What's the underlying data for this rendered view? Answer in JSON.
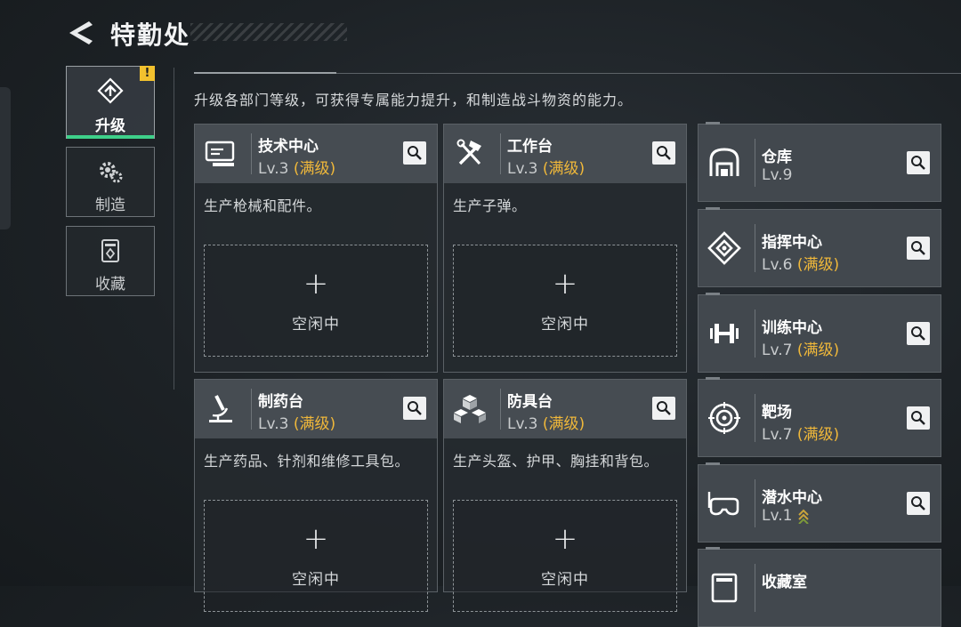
{
  "header": {
    "title": "特勤处"
  },
  "side_nav": [
    {
      "label": "升级",
      "icon": "upgrade-icon",
      "active": true,
      "alert": "!"
    },
    {
      "label": "制造",
      "icon": "gears-icon",
      "active": false
    },
    {
      "label": "收藏",
      "icon": "collection-icon",
      "active": false
    }
  ],
  "description": "升级各部门等级，可获得专属能力提升，和制造战斗物资的能力。",
  "status_full": "(满级)",
  "slot": {
    "plus": "+",
    "idle_label": "空闲中"
  },
  "cards": [
    {
      "name": "技术中心",
      "level": "Lv.3",
      "desc": "生产枪械和配件。",
      "icon": "computer-icon"
    },
    {
      "name": "工作台",
      "level": "Lv.3",
      "desc": "生产子弹。",
      "icon": "tools-icon"
    },
    {
      "name": "制药台",
      "level": "Lv.3",
      "desc": "生产药品、针剂和维修工具包。",
      "icon": "microscope-icon"
    },
    {
      "name": "防具台",
      "level": "Lv.3",
      "desc": "生产头盔、护甲、胸挂和背包。",
      "icon": "armor-blocks-icon"
    }
  ],
  "facilities": [
    {
      "name": "仓库",
      "level": "Lv.9",
      "full": false,
      "icon": "warehouse-icon"
    },
    {
      "name": "指挥中心",
      "level": "Lv.6",
      "full": true,
      "icon": "command-chip-icon"
    },
    {
      "name": "训练中心",
      "level": "Lv.7",
      "full": true,
      "icon": "dumbbell-icon"
    },
    {
      "name": "靶场",
      "level": "Lv.7",
      "full": true,
      "icon": "target-icon"
    },
    {
      "name": "潜水中心",
      "level": "Lv.1",
      "full": false,
      "upgradable": true,
      "icon": "diving-mask-icon"
    },
    {
      "name": "收藏室",
      "icon": "collection-room-icon"
    }
  ],
  "colors": {
    "accent_full": "#f0b83a",
    "active_bar": "#3ed08a",
    "alert": "#f2c12e"
  }
}
